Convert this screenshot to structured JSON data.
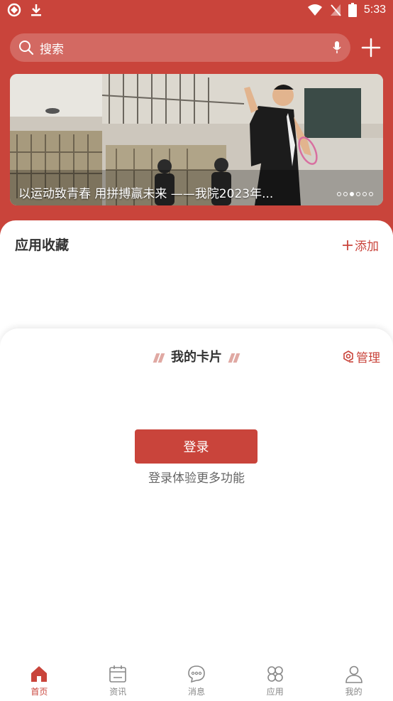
{
  "status_bar": {
    "time": "5:33"
  },
  "search": {
    "placeholder": "搜索"
  },
  "banner": {
    "caption": "以运动致青春 用拼搏赢未来 ——我院2023年...",
    "dot_count": 6,
    "active_dot": 2
  },
  "favorites": {
    "title": "应用收藏",
    "add_label": "添加"
  },
  "cards": {
    "title": "我的卡片",
    "manage_label": "管理",
    "login_button": "登录",
    "login_hint": "登录体验更多功能"
  },
  "nav": {
    "items": [
      {
        "label": "首页",
        "icon": "home-icon",
        "active": true
      },
      {
        "label": "资讯",
        "icon": "calendar-icon",
        "active": false
      },
      {
        "label": "消息",
        "icon": "chat-icon",
        "active": false
      },
      {
        "label": "应用",
        "icon": "apps-icon",
        "active": false
      },
      {
        "label": "我的",
        "icon": "user-icon",
        "active": false
      }
    ]
  },
  "colors": {
    "brand": "#c9443b",
    "inactive": "#888888"
  }
}
